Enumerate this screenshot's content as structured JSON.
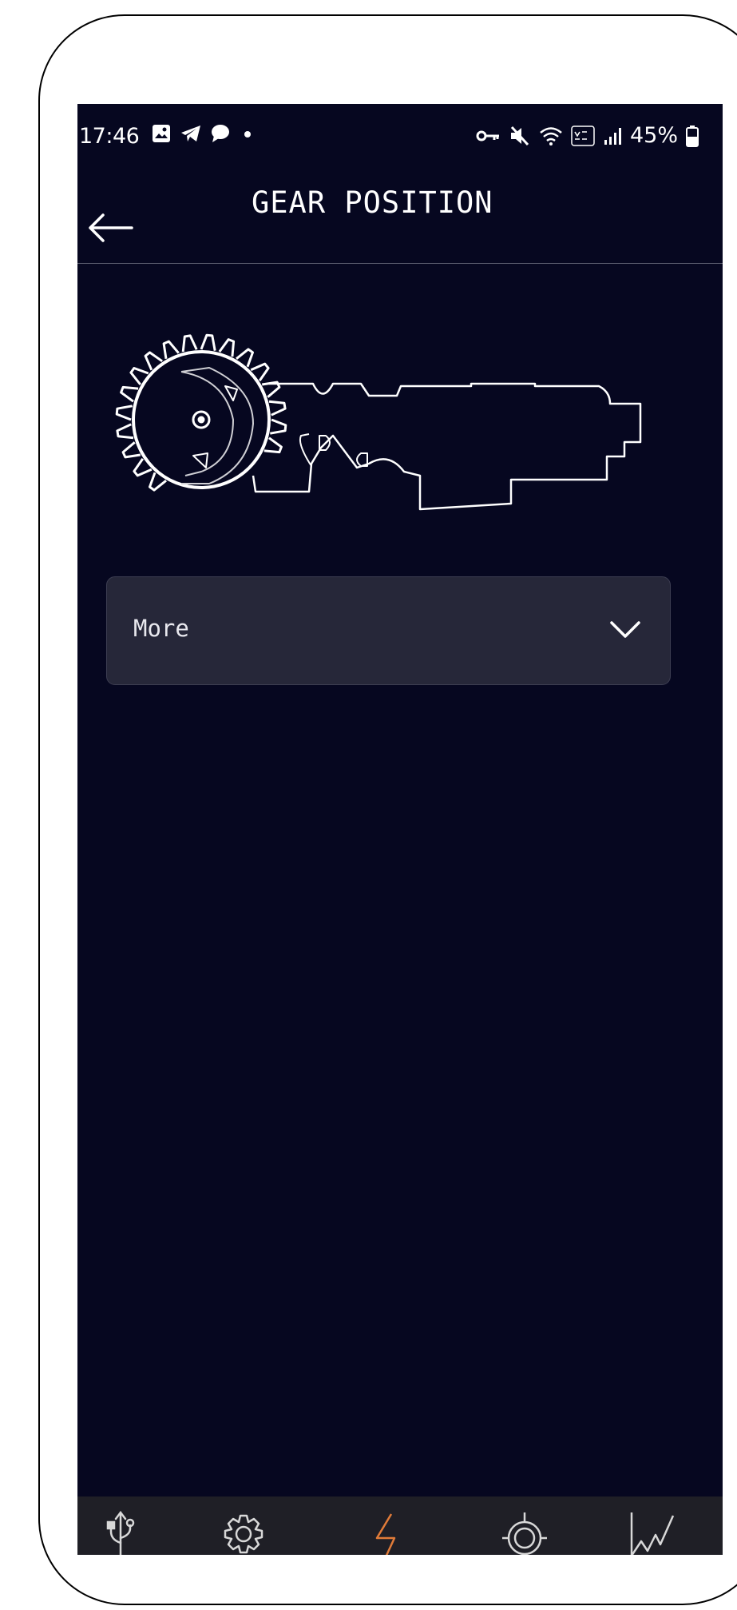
{
  "status_bar": {
    "time": "17:46",
    "battery_percent": "45%",
    "left_icons": [
      "image-icon",
      "telegram-icon",
      "chat-icon",
      "dot-icon"
    ],
    "right_icons": [
      "vpn-key-icon",
      "mute-icon",
      "wifi-icon",
      "volte-icon",
      "signal-icon",
      "battery-icon"
    ]
  },
  "header": {
    "title": "GEAR POSITION",
    "back_icon": "back-arrow-icon"
  },
  "dropdown": {
    "label": "More",
    "icon": "chevron-down-icon"
  },
  "bottom_nav": {
    "items": [
      {
        "icon": "usb-icon",
        "active": false
      },
      {
        "icon": "gear-icon",
        "active": false
      },
      {
        "icon": "lightning-icon",
        "active": true
      },
      {
        "icon": "target-icon",
        "active": false
      },
      {
        "icon": "chart-icon",
        "active": false
      }
    ],
    "active_color": "#e07b39",
    "inactive_color": "#d8d8d8"
  },
  "colors": {
    "background": "#060720",
    "dropdown_bg": "#262739",
    "nav_bg": "#1f1f26"
  }
}
